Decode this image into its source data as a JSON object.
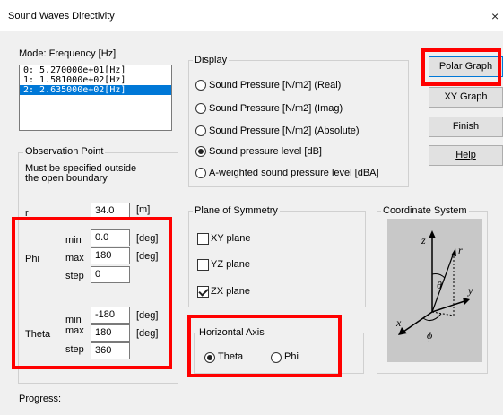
{
  "window": {
    "title": "Sound Waves Directivity",
    "close_glyph": "×"
  },
  "mode": {
    "label": "Mode: Frequency [Hz]",
    "items": [
      "0: 5.270000e+01[Hz]",
      "1: 1.581000e+02[Hz]",
      "2: 2.635000e+02[Hz]"
    ],
    "selected_index": 2
  },
  "observation": {
    "title": "Observation Point",
    "note_line1": "Must be specified outside",
    "note_line2": "the open boundary",
    "r_label": "r",
    "r_value": "34.0",
    "r_unit": "[m]",
    "phi": {
      "label": "Phi",
      "min_label": "min",
      "min": "0.0",
      "max_label": "max",
      "max": "180",
      "step_label": "step",
      "step": "0",
      "unit": "[deg]"
    },
    "theta": {
      "label": "Theta",
      "min_label": "min",
      "min": "-180",
      "max_label": "max",
      "max": "180",
      "step_label": "step",
      "step": "360",
      "unit": "[deg]"
    }
  },
  "display": {
    "title": "Display",
    "options": [
      "Sound Pressure [N/m2] (Real)",
      "Sound Pressure [N/m2] (Imag)",
      "Sound Pressure [N/m2] (Absolute)",
      "Sound pressure level [dB]",
      "A-weighted sound pressure level [dBA]"
    ],
    "selected_index": 3
  },
  "symmetry": {
    "title": "Plane of Symmetry",
    "options": [
      "XY plane",
      "YZ plane",
      "ZX plane"
    ],
    "checked": [
      false,
      false,
      true
    ]
  },
  "horizontal_axis": {
    "title": "Horizontal Axis",
    "options": [
      "Theta",
      "Phi"
    ],
    "selected_index": 0
  },
  "coordinate": {
    "title": "Coordinate System",
    "z": "z",
    "r": "r",
    "theta": "θ",
    "y": "y",
    "x": "x",
    "phi": "ϕ"
  },
  "buttons": {
    "polar": "Polar Graph",
    "xy": "XY Graph",
    "finish": "Finish",
    "help": "Help"
  },
  "progress_label": "Progress:",
  "highlight_color": "#ff0000",
  "selection_color": "#0078d7"
}
